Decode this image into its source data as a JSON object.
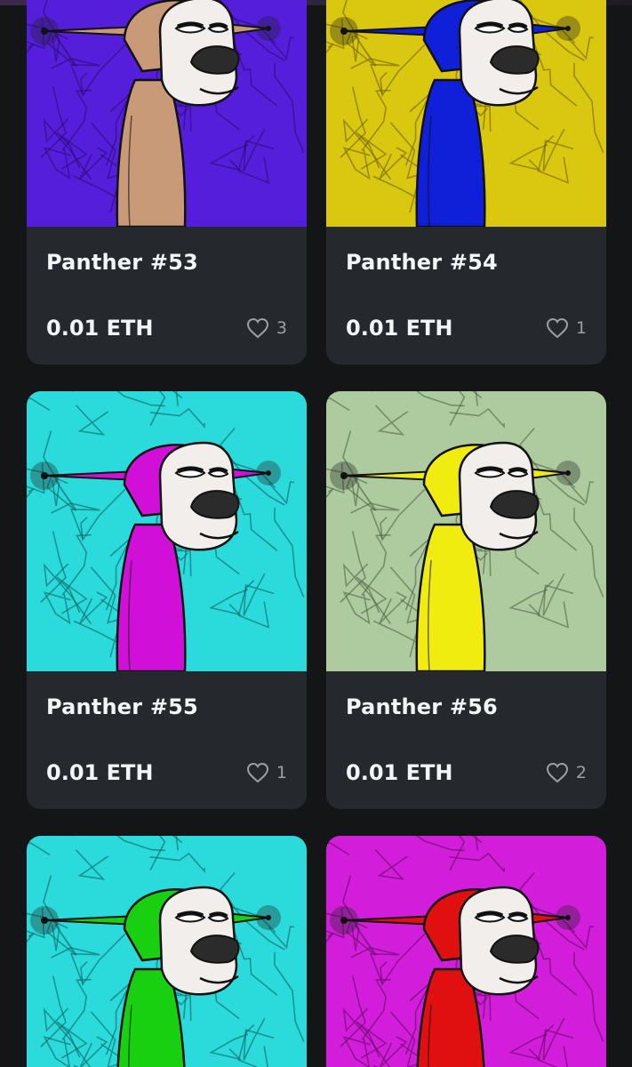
{
  "cards": [
    {
      "name": "Panther #53",
      "price": "0.01 ETH",
      "likes": "3",
      "bg": "#4a10d8",
      "body": "#c89a78",
      "crack": "#2a0a6a"
    },
    {
      "name": "Panther #54",
      "price": "0.01 ETH",
      "likes": "1",
      "bg": "#d8c400",
      "body": "#1020d8",
      "crack": "#6a5a00"
    },
    {
      "name": "Panther #55",
      "price": "0.01 ETH",
      "likes": "1",
      "bg": "#1ed8d8",
      "body": "#d010d8",
      "crack": "#0a5a5a"
    },
    {
      "name": "Panther #56",
      "price": "0.01 ETH",
      "likes": "2",
      "bg": "#a8c898",
      "body": "#f0ec10",
      "crack": "#4a5a40"
    },
    {
      "name": "",
      "price": "",
      "likes": "",
      "bg": "#1ed8d8",
      "body": "#18d010",
      "crack": "#0a5a5a"
    },
    {
      "name": "",
      "price": "",
      "likes": "",
      "bg": "#d010d8",
      "body": "#e01010",
      "crack": "#5a0a5a"
    }
  ],
  "icons": {
    "like": "heart-icon"
  }
}
